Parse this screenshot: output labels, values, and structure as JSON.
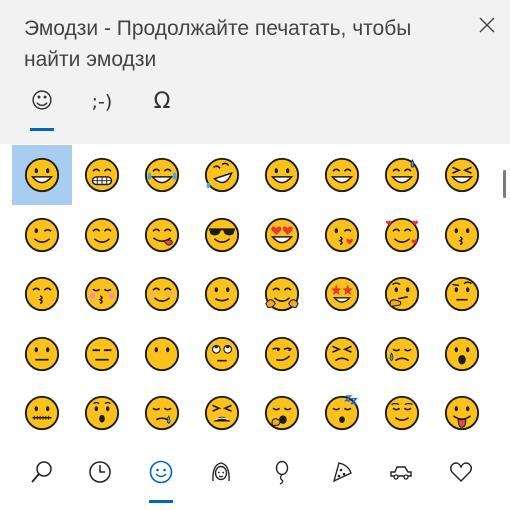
{
  "window": {
    "title": "Эмодзи - Продолжайте печатать, чтобы найти эмодзи",
    "close_icon": "close-icon"
  },
  "tabs": [
    {
      "name": "emoji",
      "glyph": "☺",
      "active": true
    },
    {
      "name": "kaomoji",
      "glyph": ";-)",
      "active": false
    },
    {
      "name": "symbols",
      "glyph": "Ω",
      "active": false
    }
  ],
  "emoji_grid": {
    "selected_index": 0,
    "items": [
      {
        "name": "grinning-face"
      },
      {
        "name": "grimacing-face"
      },
      {
        "name": "face-with-tears-of-joy"
      },
      {
        "name": "rolling-on-the-floor-laughing"
      },
      {
        "name": "smiley-face"
      },
      {
        "name": "grinning-smiling-eyes"
      },
      {
        "name": "grinning-face-with-sweat"
      },
      {
        "name": "laughing-squinting-face"
      },
      {
        "name": "winking-face"
      },
      {
        "name": "smiling-face-with-smiling-eyes"
      },
      {
        "name": "face-savoring-food"
      },
      {
        "name": "smiling-face-with-sunglasses"
      },
      {
        "name": "heart-eyes-face"
      },
      {
        "name": "face-blowing-a-kiss"
      },
      {
        "name": "smiling-face-with-hearts"
      },
      {
        "name": "kissing-face"
      },
      {
        "name": "kissing-face-with-smiling-eyes"
      },
      {
        "name": "kissing-face-with-closed-eyes"
      },
      {
        "name": "smiling-face"
      },
      {
        "name": "slightly-smiling-face"
      },
      {
        "name": "hugging-face"
      },
      {
        "name": "star-struck"
      },
      {
        "name": "thinking-face"
      },
      {
        "name": "face-with-raised-eyebrow"
      },
      {
        "name": "neutral-face"
      },
      {
        "name": "expressionless-face"
      },
      {
        "name": "face-without-mouth"
      },
      {
        "name": "face-with-rolling-eyes"
      },
      {
        "name": "smirking-face"
      },
      {
        "name": "persevering-face"
      },
      {
        "name": "sad-but-relieved-face"
      },
      {
        "name": "face-with-open-mouth"
      },
      {
        "name": "zipper-mouth-face"
      },
      {
        "name": "hushed-face"
      },
      {
        "name": "sleepy-face"
      },
      {
        "name": "tired-face"
      },
      {
        "name": "yawning-face"
      },
      {
        "name": "sleeping-face"
      },
      {
        "name": "relieved-face"
      },
      {
        "name": "face-with-tongue"
      }
    ]
  },
  "categories": [
    {
      "name": "search",
      "active": false
    },
    {
      "name": "recently-used",
      "active": false
    },
    {
      "name": "smileys-and-animals",
      "active": true
    },
    {
      "name": "people",
      "active": false
    },
    {
      "name": "celebrations-and-objects",
      "active": false
    },
    {
      "name": "food-and-plants",
      "active": false
    },
    {
      "name": "transportation-and-places",
      "active": false
    },
    {
      "name": "symbols-hearts",
      "active": false
    }
  ],
  "colors": {
    "accent": "#0067c0",
    "selection": "#a8cdf0",
    "emoji_fill": "#fcc21b",
    "emoji_outline": "#1b1b1b",
    "header_bg": "#f2f2f2"
  }
}
